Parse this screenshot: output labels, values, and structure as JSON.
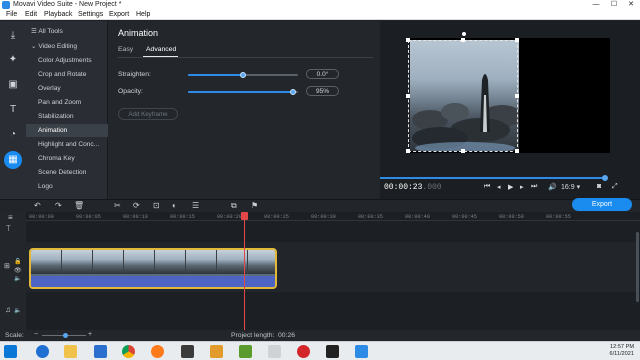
{
  "window": {
    "title": "Movavi Video Suite - New Project *",
    "controls": [
      "—",
      "☐",
      "✕"
    ]
  },
  "menu": [
    "File",
    "Edit",
    "Playback",
    "Settings",
    "Export",
    "Help"
  ],
  "rail_icons": [
    "import-icon",
    "effects-wand-icon",
    "filters-icon",
    "titles-icon",
    "transitions-icon",
    "more-tools-icon"
  ],
  "categories": {
    "all_tools": "All Tools",
    "video_editing": "Video Editing",
    "items": [
      "Color Adjustments",
      "Crop and Rotate",
      "Overlay",
      "Pan and Zoom",
      "Stabilization",
      "Animation",
      "Highlight and Conc...",
      "Chroma Key",
      "Scene Detection",
      "Logo"
    ],
    "selected": "Animation"
  },
  "panel": {
    "title": "Animation",
    "tabs": [
      "Easy",
      "Advanced"
    ],
    "active_tab": "Advanced",
    "straighten": {
      "label": "Straighten:",
      "value": "0.0°",
      "fraction": 0.5
    },
    "opacity": {
      "label": "Opacity:",
      "value": "95%",
      "fraction": 0.95
    },
    "add_keyframe": "Add Keyframe"
  },
  "player": {
    "timecode": "00:00:23",
    "timecode_ms": ".000",
    "aspect": "16:9 ▾",
    "seek_fraction": 0.97
  },
  "timeline": {
    "ticks": [
      "00:00:00",
      "00:00:05",
      "00:00:10",
      "00:00:15",
      "00:00:20",
      "00:00:25",
      "00:00:30",
      "00:00:35",
      "00:00:40",
      "00:00:45",
      "00:00:50",
      "00:00:55"
    ],
    "export_label": "Export"
  },
  "status": {
    "scale_label": "Scale:",
    "project_length_label": "Project length:",
    "project_length": "00:26"
  },
  "taskbar": {
    "time": "12:57 PM",
    "date": "6/11/2021"
  },
  "colors": {
    "accent": "#1a8cf0",
    "clip_border": "#e2b83a",
    "audio": "#4d64c4",
    "playhead": "#e24848"
  }
}
